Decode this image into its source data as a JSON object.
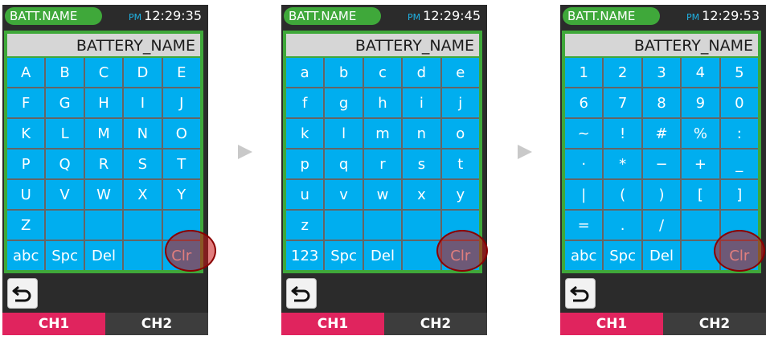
{
  "colors": {
    "accent_green": "#3fa83a",
    "key_blue": "#00aeef",
    "ch1_active": "#e0245e",
    "ch2": "#3d3d3d",
    "highlight": "#c81414"
  },
  "screens": [
    {
      "title": "BATT.NAME",
      "ampm": "PM",
      "time": "12:29:35",
      "field_value": "BATTERY_NAME",
      "keys": [
        [
          "A",
          "B",
          "C",
          "D",
          "E"
        ],
        [
          "F",
          "G",
          "H",
          "I",
          "J"
        ],
        [
          "K",
          "L",
          "M",
          "N",
          "O"
        ],
        [
          "P",
          "Q",
          "R",
          "S",
          "T"
        ],
        [
          "U",
          "V",
          "W",
          "X",
          "Y"
        ],
        [
          "Z",
          "",
          "",
          "",
          ""
        ],
        [
          "abc",
          "Spc",
          "Del",
          "",
          "Clr"
        ]
      ],
      "tabs": [
        "CH1",
        "CH2"
      ],
      "back_icon": "back-arrow-icon"
    },
    {
      "title": "BATT.NAME",
      "ampm": "PM",
      "time": "12:29:45",
      "field_value": "BATTERY_NAME",
      "keys": [
        [
          "a",
          "b",
          "c",
          "d",
          "e"
        ],
        [
          "f",
          "g",
          "h",
          "i",
          "j"
        ],
        [
          "k",
          "l",
          "m",
          "n",
          "o"
        ],
        [
          "p",
          "q",
          "r",
          "s",
          "t"
        ],
        [
          "u",
          "v",
          "w",
          "x",
          "y"
        ],
        [
          "z",
          "",
          "",
          "",
          ""
        ],
        [
          "123",
          "Spc",
          "Del",
          "",
          "Clr"
        ]
      ],
      "tabs": [
        "CH1",
        "CH2"
      ],
      "back_icon": "back-arrow-icon"
    },
    {
      "title": "BATT.NAME",
      "ampm": "PM",
      "time": "12:29:53",
      "field_value": "BATTERY_NAME",
      "keys": [
        [
          "1",
          "2",
          "3",
          "4",
          "5"
        ],
        [
          "6",
          "7",
          "8",
          "9",
          "0"
        ],
        [
          "~",
          "!",
          "#",
          "%",
          ":"
        ],
        [
          "·",
          "*",
          "−",
          "+",
          "_"
        ],
        [
          "|",
          "(",
          ")",
          "[",
          "]"
        ],
        [
          "=",
          ".",
          "/",
          "",
          ""
        ],
        [
          "abc",
          "Spc",
          "Del",
          "",
          "Clr"
        ]
      ],
      "tabs": [
        "CH1",
        "CH2"
      ],
      "back_icon": "back-arrow-icon"
    }
  ],
  "arrows": [
    "right-arrow-icon",
    "right-arrow-icon"
  ]
}
